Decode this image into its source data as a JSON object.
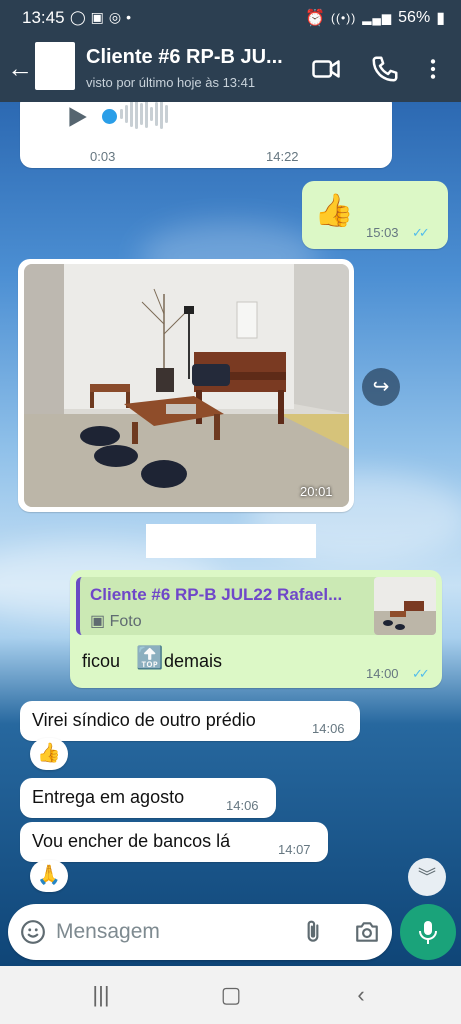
{
  "status_bar": {
    "time": "13:45",
    "notif_icons": [
      "whatsapp-icon",
      "image-icon",
      "chrome-icon",
      "dot-icon"
    ],
    "battery": "56%"
  },
  "header": {
    "title": "Cliente #6 RP-B JU...",
    "subtitle": "visto por último hoje às 13:41",
    "icons": [
      "back-arrow-icon",
      "video-call-icon",
      "phone-icon",
      "more-vert-icon"
    ]
  },
  "messages": {
    "audio": {
      "elapsed": "0:03",
      "time": "14:22"
    },
    "thumbs": {
      "emoji": "👍",
      "time": "15:03"
    },
    "photo": {
      "time": "20:01"
    },
    "reply": {
      "quote_name": "Cliente #6 RP-B JUL22 Rafael...",
      "quote_type": "Foto",
      "text_before": "ficou",
      "top_emoji": "🔝",
      "text_after": "demais",
      "time": "14:00"
    },
    "m1": {
      "text": "Virei síndico de outro prédio",
      "time": "14:06",
      "reaction": "👍"
    },
    "m2": {
      "text": "Entrega em agosto",
      "time": "14:06"
    },
    "m3": {
      "text": "Vou encher de bancos lá",
      "time": "14:07",
      "reaction": "🙏"
    }
  },
  "composer": {
    "placeholder": "Mensagem"
  },
  "colors": {
    "header": "#2c3f51",
    "outgoing": "#dcf8c6",
    "incoming": "#ffffff",
    "accent": "#1aa37a",
    "read_ticks": "#53bdeb"
  }
}
